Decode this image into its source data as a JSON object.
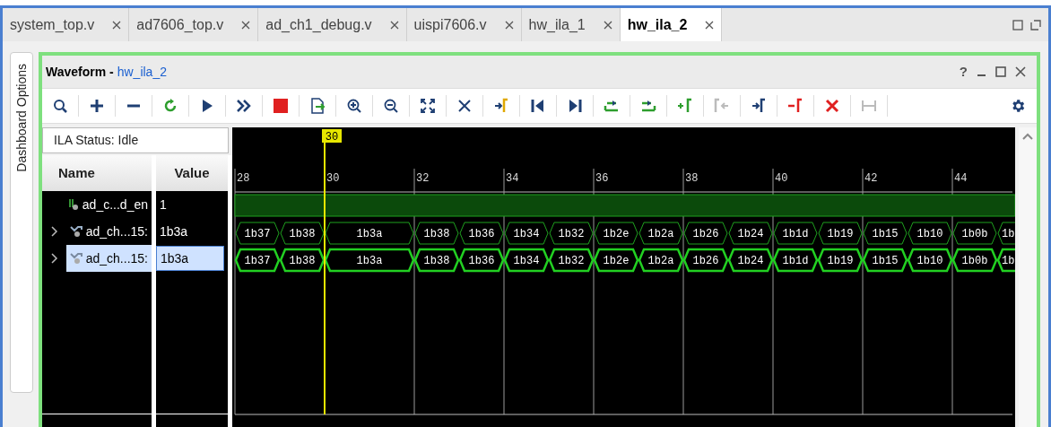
{
  "tabs": [
    {
      "label": "system_top.v",
      "selected": false
    },
    {
      "label": "ad7606_top.v",
      "selected": false
    },
    {
      "label": "ad_ch1_debug.v",
      "selected": false
    },
    {
      "label": "uispi7606.v",
      "selected": false
    },
    {
      "label": "hw_ila_1",
      "selected": false
    },
    {
      "label": "hw_ila_2",
      "selected": true
    }
  ],
  "side_tab": "Dashboard Options",
  "window": {
    "title": "Waveform -",
    "subtitle": "hw_ila_2",
    "help": "?"
  },
  "toolbar": [
    {
      "kind": "search",
      "disabled": false
    },
    {
      "kind": "plus",
      "disabled": false
    },
    {
      "kind": "minus",
      "disabled": false
    },
    {
      "kind": "refresh",
      "disabled": false
    },
    {
      "kind": "play",
      "disabled": false
    },
    {
      "kind": "fast",
      "disabled": false
    },
    {
      "kind": "stop",
      "disabled": false
    },
    {
      "kind": "export",
      "disabled": false
    },
    {
      "kind": "zoom-in",
      "disabled": false
    },
    {
      "kind": "zoom-out",
      "disabled": false
    },
    {
      "kind": "fit",
      "disabled": false
    },
    {
      "kind": "cross",
      "disabled": false
    },
    {
      "kind": "marker-yellow",
      "disabled": false
    },
    {
      "kind": "first",
      "disabled": false
    },
    {
      "kind": "last",
      "disabled": false
    },
    {
      "kind": "swap",
      "disabled": false
    },
    {
      "kind": "swap2",
      "disabled": false
    },
    {
      "kind": "marker-add",
      "disabled": false
    },
    {
      "kind": "marker-prev",
      "disabled": true
    },
    {
      "kind": "marker-next",
      "disabled": false
    },
    {
      "kind": "marker-remove",
      "disabled": false
    },
    {
      "kind": "delete",
      "disabled": false
    },
    {
      "kind": "span",
      "disabled": true
    }
  ],
  "status": "ILA Status: Idle",
  "columns": [
    "Name",
    "Value"
  ],
  "signals": [
    {
      "name": "ad_c...d_en",
      "value": "1",
      "kind": "bit",
      "expandable": false,
      "selected": false
    },
    {
      "name": "ad_ch...15:",
      "value": "1b3a",
      "kind": "bus",
      "expandable": true,
      "selected": false,
      "segments": [
        {
          "value": "1b37",
          "wide": false
        },
        {
          "value": "1b38",
          "wide": false
        },
        {
          "value": "1b3a",
          "wide": true
        },
        {
          "value": "1b38",
          "wide": false
        },
        {
          "value": "1b36",
          "wide": false
        },
        {
          "value": "1b34",
          "wide": false
        },
        {
          "value": "1b32",
          "wide": false
        },
        {
          "value": "1b2e",
          "wide": false
        },
        {
          "value": "1b2a",
          "wide": false
        },
        {
          "value": "1b26",
          "wide": false
        },
        {
          "value": "1b24",
          "wide": false
        },
        {
          "value": "1b1d",
          "wide": false
        },
        {
          "value": "1b19",
          "wide": false
        },
        {
          "value": "1b15",
          "wide": false
        },
        {
          "value": "1b10",
          "wide": false
        },
        {
          "value": "1b0b",
          "wide": false
        },
        {
          "value": "1b",
          "wide": true
        }
      ]
    },
    {
      "name": "ad_ch...15:",
      "value": "1b3a",
      "kind": "bus",
      "expandable": true,
      "selected": true,
      "segments": [
        {
          "value": "1b37",
          "wide": false
        },
        {
          "value": "1b38",
          "wide": false
        },
        {
          "value": "1b3a",
          "wide": true
        },
        {
          "value": "1b38",
          "wide": false
        },
        {
          "value": "1b36",
          "wide": false
        },
        {
          "value": "1b34",
          "wide": false
        },
        {
          "value": "1b32",
          "wide": false
        },
        {
          "value": "1b2e",
          "wide": false
        },
        {
          "value": "1b2a",
          "wide": false
        },
        {
          "value": "1b26",
          "wide": false
        },
        {
          "value": "1b24",
          "wide": false
        },
        {
          "value": "1b1d",
          "wide": false
        },
        {
          "value": "1b19",
          "wide": false
        },
        {
          "value": "1b15",
          "wide": false
        },
        {
          "value": "1b10",
          "wide": false
        },
        {
          "value": "1b0b",
          "wide": false
        },
        {
          "value": "1b",
          "wide": true
        }
      ]
    }
  ],
  "cursor": "30",
  "time_ticks": [
    "28",
    "30",
    "32",
    "34",
    "36",
    "38",
    "40",
    "42",
    "44"
  ]
}
